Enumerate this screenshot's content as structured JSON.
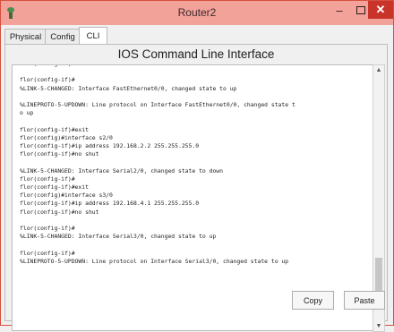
{
  "window": {
    "title": "Router2",
    "title_bar_color": "#f3a29a",
    "close_color": "#c9342a"
  },
  "window_controls": {
    "minimize": "–",
    "close": "✕"
  },
  "tabs": [
    {
      "label": "Physical"
    },
    {
      "label": "Config"
    },
    {
      "label": "CLI",
      "active": true
    }
  ],
  "panel": {
    "heading": "IOS Command Line Interface"
  },
  "console": {
    "lines": [
      "flor(config-if)#no shut",
      "",
      "flor(config-if)#",
      "%LINK-5-CHANGED: Interface FastEthernet0/0, changed state to up",
      "",
      "%LINEPROTO-5-UPDOWN: Line protocol on Interface FastEthernet0/0, changed state t",
      "o up",
      "",
      "flor(config-if)#exit",
      "flor(config)#interface s2/0",
      "flor(config-if)#ip address 192.168.2.2 255.255.255.0",
      "flor(config-if)#no shut",
      "",
      "%LINK-5-CHANGED: Interface Serial2/0, changed state to down",
      "flor(config-if)#",
      "flor(config-if)#exit",
      "flor(config)#interface s3/0",
      "flor(config-if)#ip address 192.168.4.1 255.255.255.0",
      "flor(config-if)#no shut",
      "",
      "flor(config-if)#",
      "%LINK-5-CHANGED: Interface Serial3/0, changed state to up",
      "",
      "flor(config-if)#",
      "%LINEPROTO-5-UPDOWN: Line protocol on Interface Serial3/0, changed state to up"
    ]
  },
  "buttons": {
    "copy": "Copy",
    "paste": "Paste"
  }
}
